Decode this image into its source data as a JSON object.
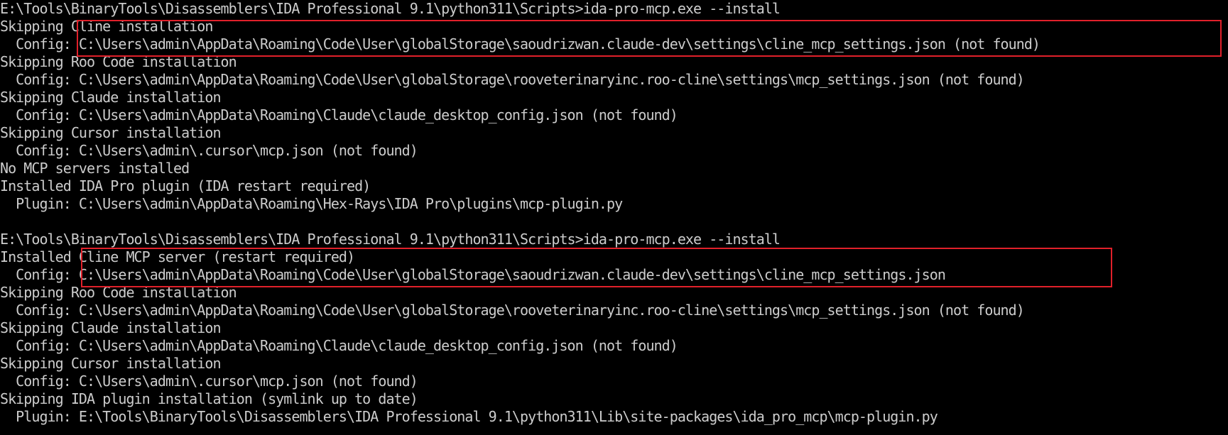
{
  "terminal": {
    "lines": [
      "E:\\Tools\\BinaryTools\\Disassemblers\\IDA Professional 9.1\\python311\\Scripts>ida-pro-mcp.exe --install",
      "Skipping Cline installation",
      "  Config: C:\\Users\\admin\\AppData\\Roaming\\Code\\User\\globalStorage\\saoudrizwan.claude-dev\\settings\\cline_mcp_settings.json (not found)",
      "Skipping Roo Code installation",
      "  Config: C:\\Users\\admin\\AppData\\Roaming\\Code\\User\\globalStorage\\rooveterinaryinc.roo-cline\\settings\\mcp_settings.json (not found)",
      "Skipping Claude installation",
      "  Config: C:\\Users\\admin\\AppData\\Roaming\\Claude\\claude_desktop_config.json (not found)",
      "Skipping Cursor installation",
      "  Config: C:\\Users\\admin\\.cursor\\mcp.json (not found)",
      "No MCP servers installed",
      "Installed IDA Pro plugin (IDA restart required)",
      "  Plugin: C:\\Users\\admin\\AppData\\Roaming\\Hex-Rays\\IDA Pro\\plugins\\mcp-plugin.py",
      "",
      "E:\\Tools\\BinaryTools\\Disassemblers\\IDA Professional 9.1\\python311\\Scripts>ida-pro-mcp.exe --install",
      "Installed Cline MCP server (restart required)",
      "  Config: C:\\Users\\admin\\AppData\\Roaming\\Code\\User\\globalStorage\\saoudrizwan.claude-dev\\settings\\cline_mcp_settings.json",
      "Skipping Roo Code installation",
      "  Config: C:\\Users\\admin\\AppData\\Roaming\\Code\\User\\globalStorage\\rooveterinaryinc.roo-cline\\settings\\mcp_settings.json (not found)",
      "Skipping Claude installation",
      "  Config: C:\\Users\\admin\\AppData\\Roaming\\Claude\\claude_desktop_config.json (not found)",
      "Skipping Cursor installation",
      "  Config: C:\\Users\\admin\\.cursor\\mcp.json (not found)",
      "Skipping IDA plugin installation (symlink up to date)",
      "  Plugin: E:\\Tools\\BinaryTools\\Disassemblers\\IDA Professional 9.1\\python311\\Lib\\site-packages\\ida_pro_mcp\\mcp-plugin.py"
    ]
  },
  "colors": {
    "background": "#000000",
    "text": "#cccccc",
    "highlight_box": "#e0202a"
  }
}
